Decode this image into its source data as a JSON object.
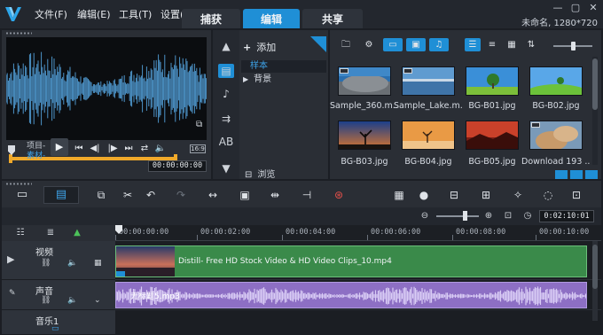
{
  "menu": {
    "file": "文件(F)",
    "edit": "编辑(E)",
    "tools": "工具(T)",
    "settings": "设置("
  },
  "tabs": {
    "capture": "捕获",
    "edit": "编辑",
    "share": "共享",
    "active": "edit"
  },
  "project_info": "未命名, 1280*720",
  "preview": {
    "mode_project": "项目-",
    "mode_clip": "素材-",
    "aspect_ratio": "16:9",
    "timecode": "00:00:00:00"
  },
  "library": {
    "add_label": "添加",
    "folders": [
      "样本",
      "背景"
    ],
    "browse_label": "浏览",
    "thumbnails": [
      {
        "label": "Sample_360.m...",
        "kind": "video"
      },
      {
        "label": "Sample_Lake.m...",
        "kind": "video"
      },
      {
        "label": "BG-B01.jpg",
        "kind": "image"
      },
      {
        "label": "BG-B02.jpg",
        "kind": "image"
      },
      {
        "label": "BG-B03.jpg",
        "kind": "image"
      },
      {
        "label": "BG-B04.jpg",
        "kind": "image"
      },
      {
        "label": "BG-B05.jpg",
        "kind": "image"
      },
      {
        "label": "Download 193 ...",
        "kind": "video"
      }
    ]
  },
  "timeline": {
    "timecode": "0:02:10:01",
    "ruler_labels": [
      "00:00:00:00",
      "00:00:02:00",
      "00:00:04:00",
      "00:00:06:00",
      "00:00:08:00",
      "00:00:10:00"
    ],
    "tracks": {
      "video": {
        "name": "视频",
        "clip_label": "Distill- Free HD Stock Video & HD Video Clips_10.mp4"
      },
      "audio": {
        "name": "声音",
        "clip_label": "无标题5.mp3"
      },
      "music": {
        "name": "音乐1"
      }
    }
  },
  "colors": {
    "accent": "#1f8fd6",
    "video_clip": "#3a8a4a",
    "audio_clip": "#8d6fc4",
    "trim": "#f0a92a"
  }
}
